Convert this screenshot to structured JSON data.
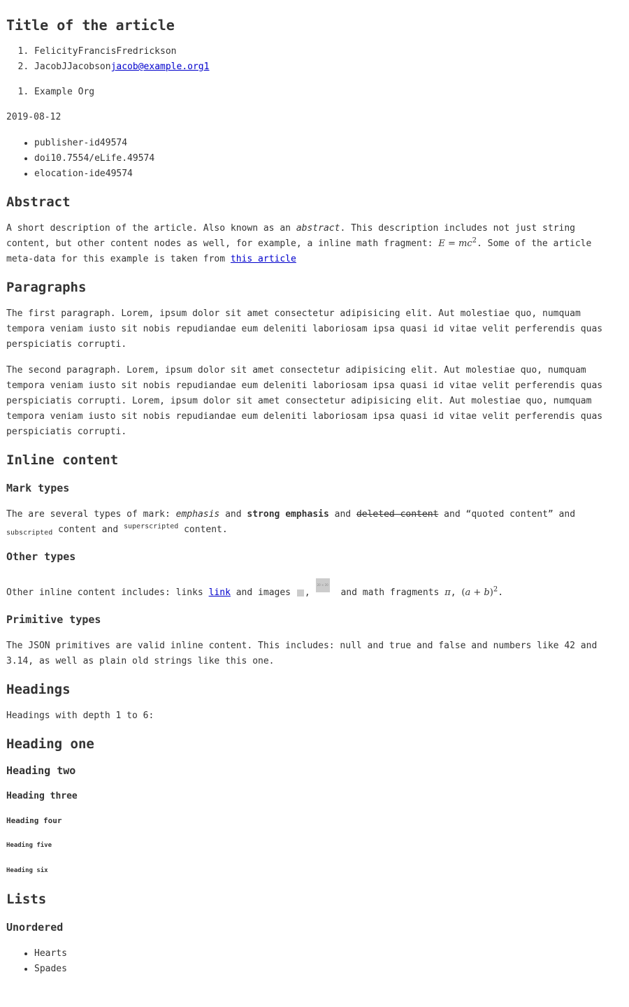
{
  "article": {
    "title": "Title of the article",
    "authors": [
      {
        "name": "FelicityFrancisFredrickson"
      },
      {
        "name": "JacobJJacobson",
        "email": "jacob@example.org1"
      }
    ],
    "affiliations": [
      "Example Org"
    ],
    "date": "2019-08-12",
    "identifiers": [
      "publisher-id49574",
      "doi10.7554/eLife.49574",
      "elocation-ide49574"
    ]
  },
  "abstract": {
    "heading": "Abstract",
    "text_1": "A short description of the article. Also known as an ",
    "em": "abstract",
    "text_2": ". This description includes not just string content, but other content nodes as well, for example, a inline math fragment: ",
    "math_E": "E",
    "math_eq": " = ",
    "math_mc": "mc",
    "math_sup": "2",
    "text_3": ". Some of the article meta-data for this example is taken from ",
    "link": "this article"
  },
  "paragraphs": {
    "heading": "Paragraphs",
    "p1": "The first paragraph. Lorem, ipsum dolor sit amet consectetur adipisicing elit. Aut molestiae quo, numquam tempora veniam iusto sit nobis repudiandae eum deleniti laboriosam ipsa quasi id vitae velit perferendis quas perspiciatis corrupti.",
    "p2": "The second paragraph. Lorem, ipsum dolor sit amet consectetur adipisicing elit. Aut molestiae quo, numquam tempora veniam iusto sit nobis repudiandae eum deleniti laboriosam ipsa quasi id vitae velit perferendis quas perspiciatis corrupti. Lorem, ipsum dolor sit amet consectetur adipisicing elit. Aut molestiae quo, numquam tempora veniam iusto sit nobis repudiandae eum deleniti laboriosam ipsa quasi id vitae velit perferendis quas perspiciatis corrupti."
  },
  "inline": {
    "heading": "Inline content",
    "mark": {
      "heading": "Mark types",
      "t1": "The are several types of mark: ",
      "emphasis": "emphasis",
      "t2": " and ",
      "strong": "strong emphasis",
      "t3": " and ",
      "deleted": "deleted content",
      "t4": " and “quoted content” and ",
      "sub": "subscripted",
      "t5": " content and ",
      "sup": "superscripted",
      "t6": " content."
    },
    "other": {
      "heading": "Other types",
      "t1": "Other inline content includes: links ",
      "link": "link",
      "t2": " and images ",
      "t3": ",",
      "t4": " and math fragments ",
      "pi": "π",
      "t5": ", ",
      "m_open": "(",
      "m_a": "a",
      "m_plus": " + ",
      "m_b": "b",
      "m_close": ")",
      "m_sup": "2",
      "t6": "."
    },
    "primitive": {
      "heading": "Primitive types",
      "text": "The JSON primitives are valid inline content. This includes: null and true and false and numbers like 42 and 3.14, as well as plain old strings like this one."
    }
  },
  "headings": {
    "heading": "Headings",
    "intro": "Headings with depth 1 to 6:",
    "h1": "Heading one",
    "h2": "Heading two",
    "h3": "Heading three",
    "h4": "Heading four",
    "h5": "Heading five",
    "h6": "Heading six"
  },
  "lists": {
    "heading": "Lists",
    "unordered": {
      "heading": "Unordered",
      "items": [
        "Hearts",
        "Spades"
      ]
    }
  }
}
